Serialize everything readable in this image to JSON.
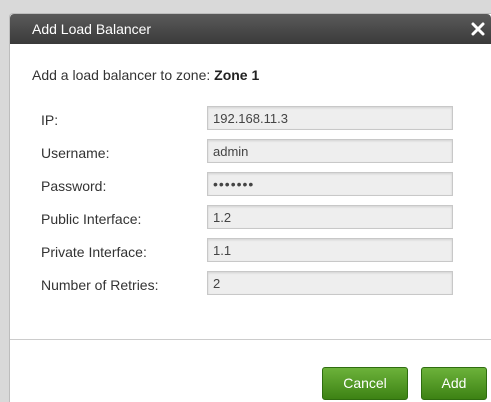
{
  "dialog": {
    "title": "Add Load Balancer",
    "subtitle_prefix": "Add a load balancer to zone: ",
    "zone_name": "Zone 1"
  },
  "fields": [
    {
      "label": "IP:",
      "value": "192.168.11.3"
    },
    {
      "label": "Username:",
      "value": "admin"
    },
    {
      "label": "Password:",
      "value": "•••••••"
    },
    {
      "label": "Public Interface:",
      "value": "1.2"
    },
    {
      "label": "Private Interface:",
      "value": "1.1"
    },
    {
      "label": "Number of Retries:",
      "value": "2"
    }
  ],
  "buttons": {
    "cancel": "Cancel",
    "add": "Add"
  },
  "colors": {
    "titlebar": "#3a3a3a",
    "button_green": "#4a9220",
    "input_bg": "#eeeeee"
  },
  "icons": {
    "close": "close-icon"
  }
}
